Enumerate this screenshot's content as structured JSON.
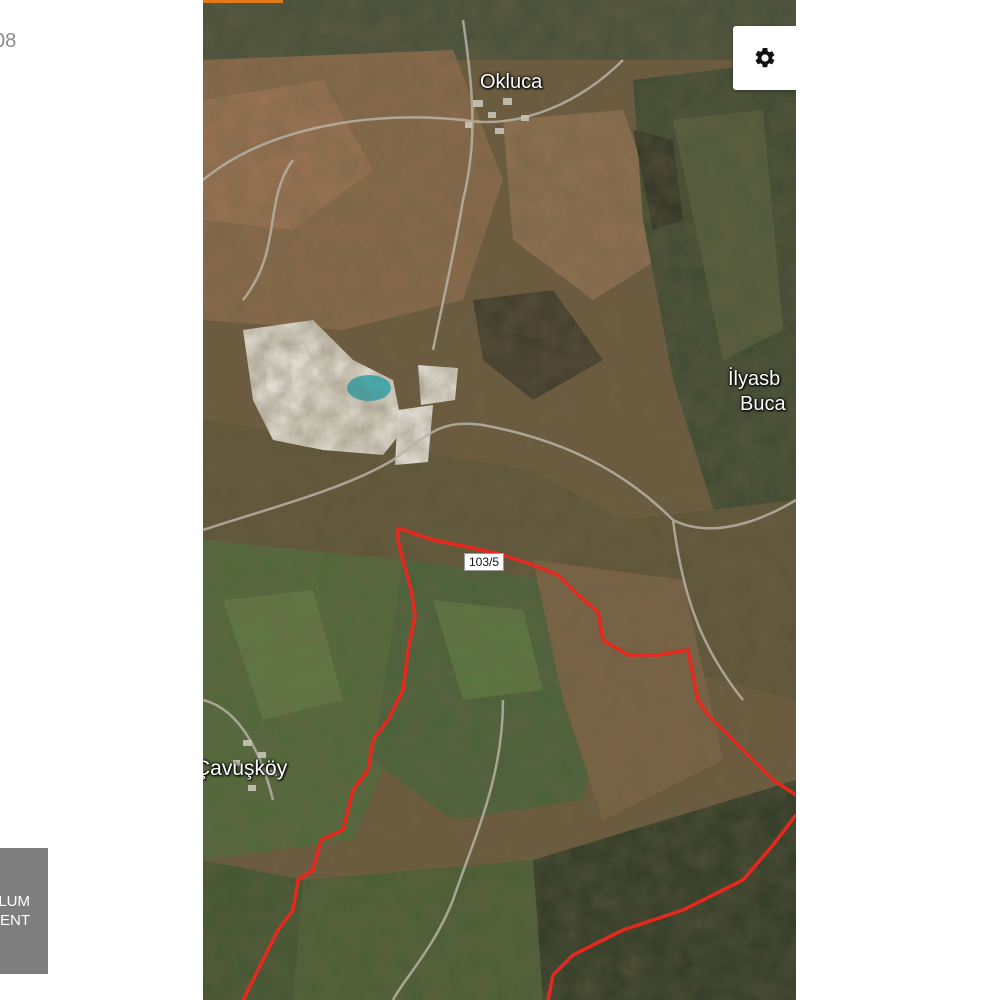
{
  "page": {
    "side_text": "08"
  },
  "logo": {
    "line1": "LUM",
    "line2": "ENT"
  },
  "map": {
    "type": "satellite",
    "settings_icon": "gear-icon",
    "places": [
      {
        "name": "Okluca"
      },
      {
        "name": "İlyasb"
      },
      {
        "name": "Buca"
      },
      {
        "name": "Çavuşköy"
      }
    ],
    "parcel": {
      "label": "103/5",
      "boundary_color": "#e8281e"
    }
  }
}
